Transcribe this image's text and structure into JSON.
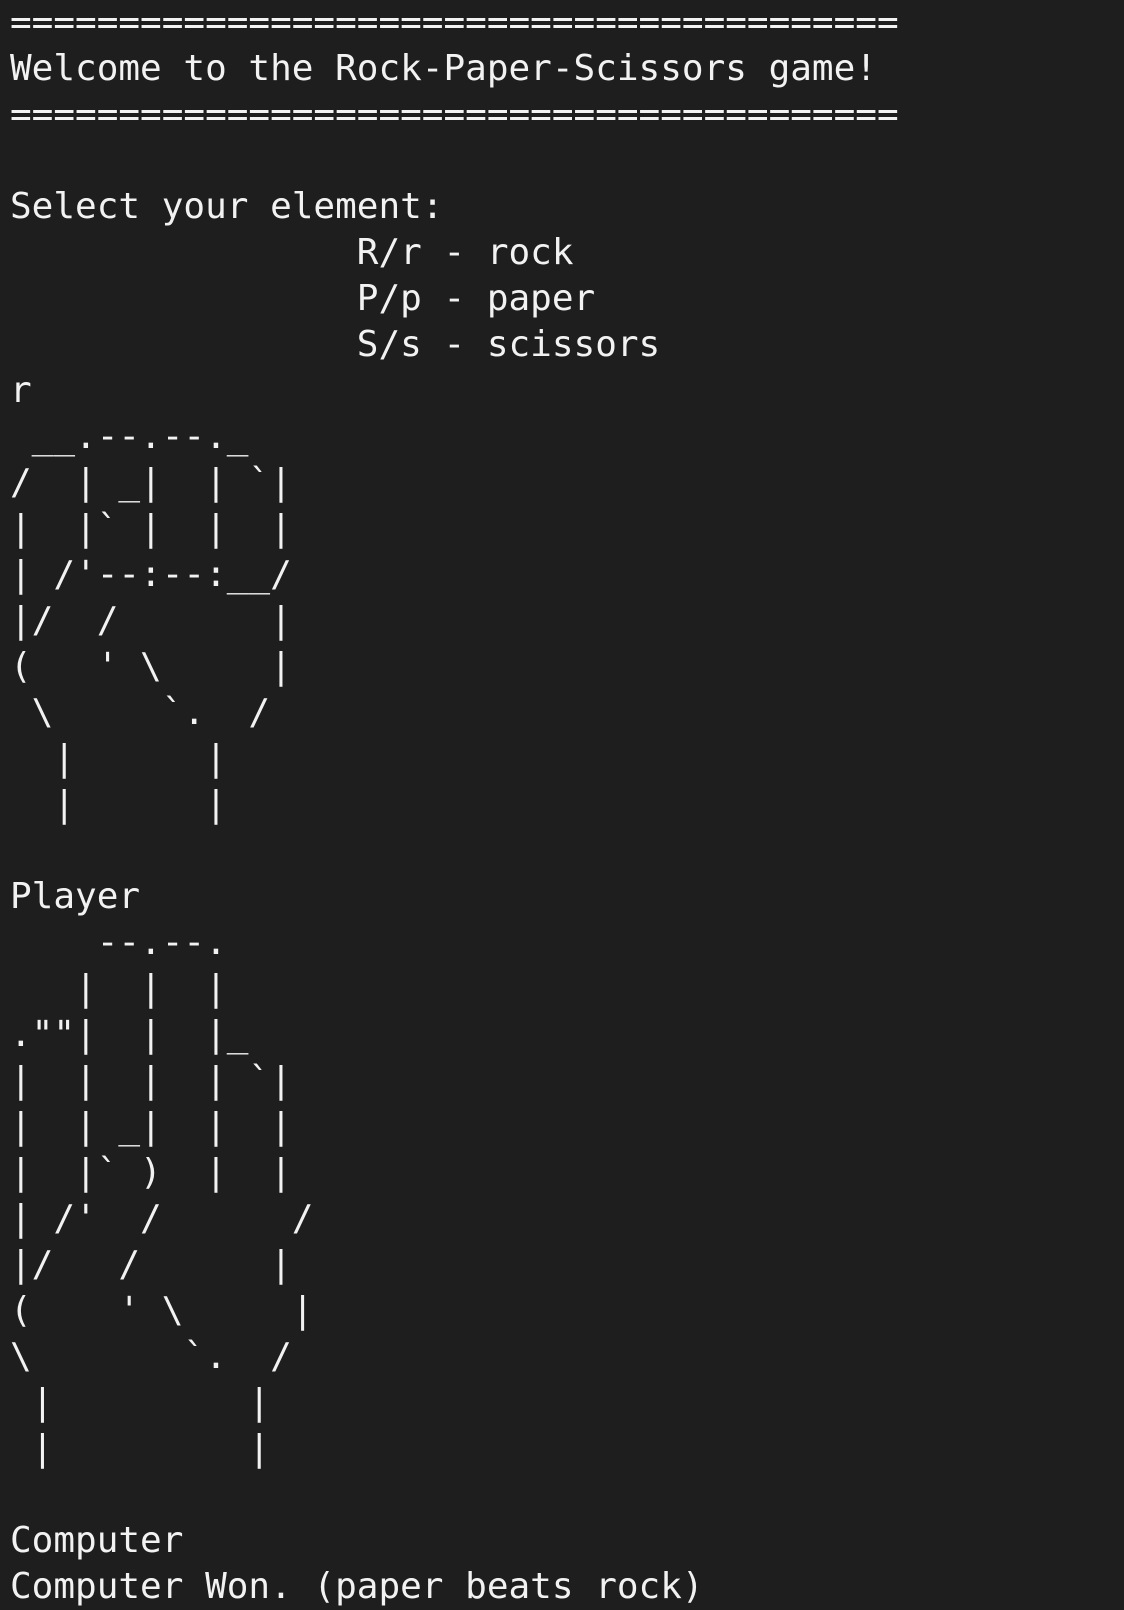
{
  "terminal": {
    "background": "#1e1e1e",
    "foreground": "#f2f2f2",
    "lines": [
      "=========================================",
      "Welcome to the Rock-Paper-Scissors game!",
      "=========================================",
      "",
      "Select your element:",
      "                R/r - rock",
      "                P/p - paper",
      "                S/s - scissors",
      "r",
      " __.--.--._",
      "/  | _|  | `|",
      "|  |` |  |  |",
      "| /'--:--:__/",
      "|/  /       |",
      "(   ' \\     |",
      " \\     `.  /",
      "  |      |",
      "  |      |",
      "",
      "Player",
      "    --.--.",
      "   |  |  |",
      ".\"\"|  |  |_",
      "|  |  |  | `|",
      "|  | _|  |  |",
      "|  |` )  |  |",
      "| /'  /      /",
      "|/   /      |",
      "(    ' \\     |",
      "\\       `.  /",
      " |         |",
      " |         |",
      "",
      "Computer",
      "Computer Won. (paper beats rock)"
    ]
  }
}
